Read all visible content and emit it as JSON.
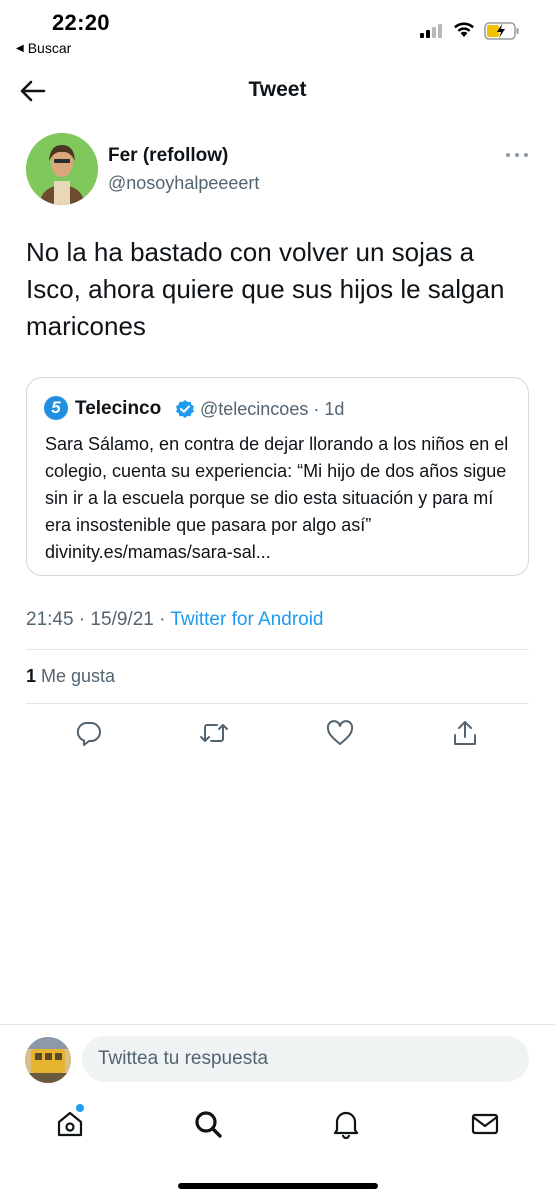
{
  "status_bar": {
    "time": "22:20",
    "back_app_label": "Buscar"
  },
  "header": {
    "title": "Tweet"
  },
  "tweet": {
    "author_name": "Fer (refollow)",
    "author_handle": "@nosoyhalpeeeert",
    "text": "No la ha bastado con volver un sojas a Isco, ahora quiere que sus hijos le salgan maricones",
    "quoted": {
      "name": "Telecinco",
      "handle_time": "@telecincoes · 1d",
      "logo_glyph": "5",
      "text": "Sara Sálamo, en contra de dejar llorando a los niños en el colegio, cuenta su experiencia: “Mi hijo de dos años sigue sin ir a la escuela porque se dio esta situación y para mí era insostenible que pasara por algo así” divinity.es/mamas/sara-sal..."
    },
    "meta_time": "21:45 · 15/9/21 · ",
    "meta_source": "Twitter for Android",
    "likes_count": "1",
    "likes_label": " Me gusta"
  },
  "reply": {
    "placeholder": "Twittea tu respuesta"
  },
  "colors": {
    "accent": "#1d9bf0",
    "secondary_text": "#536471",
    "divider": "#e1e6ea"
  },
  "icons": [
    "arrow-left-icon",
    "more-icon",
    "verified-icon",
    "reply-icon",
    "retweet-icon",
    "like-icon",
    "share-icon",
    "home-icon",
    "search-icon",
    "notifications-icon",
    "messages-icon"
  ]
}
